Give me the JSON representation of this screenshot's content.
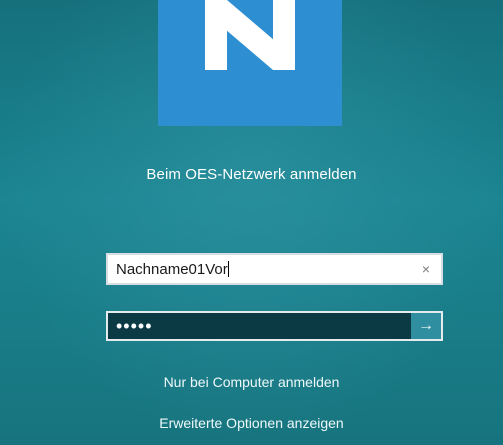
{
  "logo": {
    "icon": "n-letter-logo",
    "color": "#2d8fd1"
  },
  "title": "Beim OES-Netzwerk anmelden",
  "username": {
    "value": "Nachname01Vor",
    "clear_icon": "×"
  },
  "password": {
    "masked_value": "•••••",
    "submit_icon": "→"
  },
  "links": {
    "computer_signin": "Nur bei Computer anmelden",
    "advanced_options": "Erweiterte Optionen anzeigen"
  },
  "colors": {
    "background": "#1b8591",
    "password_field": "#0c3a44",
    "submit_button": "#2f8fa0"
  }
}
